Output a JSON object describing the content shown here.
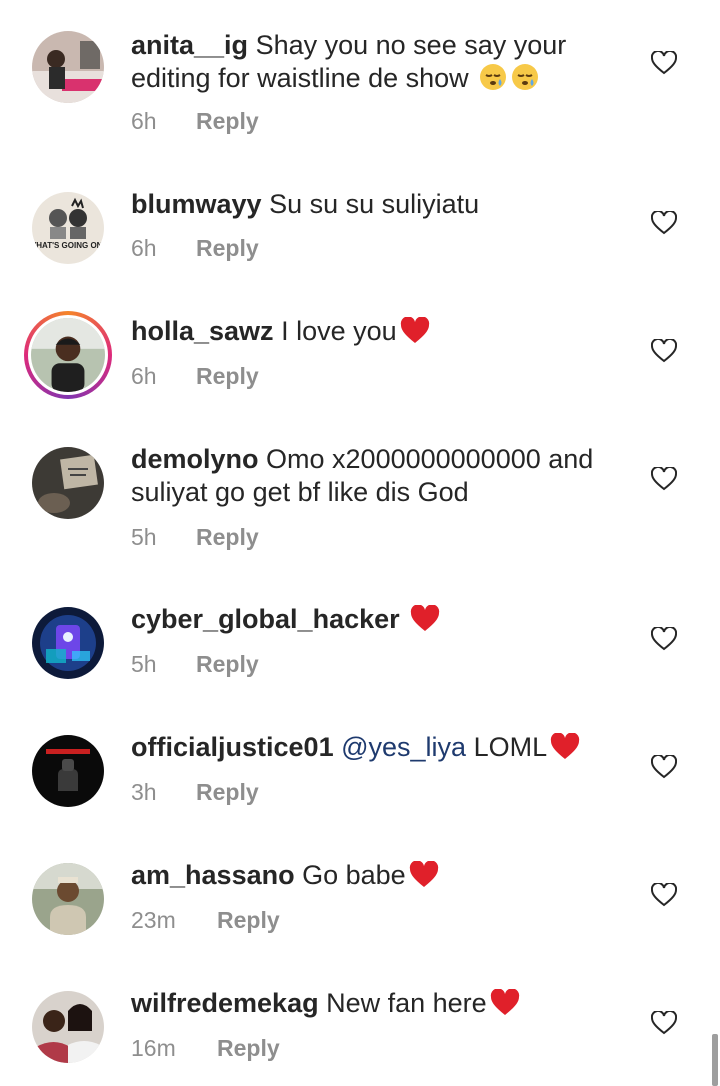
{
  "comments": [
    {
      "username": "anita__ig",
      "text": "Shay you no see say your editing for waistline de show",
      "emojis": [
        "sleepy-face",
        "sleepy-face"
      ],
      "time": "6h",
      "reply": "Reply"
    },
    {
      "username": "blumwayy",
      "text": "Su su su suliyiatu",
      "time": "6h",
      "reply": "Reply",
      "avatar_caption": "WHAT'S GOING ON?"
    },
    {
      "username": "holla_sawz",
      "text": "I love you",
      "emojis": [
        "red-heart"
      ],
      "time": "6h",
      "reply": "Reply"
    },
    {
      "username": "demolyno",
      "text": "Omo x2000000000000 and suliyat go get bf like dis God",
      "time": "5h",
      "reply": "Reply"
    },
    {
      "username": "cyber_global_hacker",
      "text": "",
      "emojis": [
        "red-heart"
      ],
      "time": "5h",
      "reply": "Reply"
    },
    {
      "username": "officialjustice01",
      "mention": "@yes_liya",
      "text": "LOML",
      "emojis": [
        "red-heart"
      ],
      "time": "3h",
      "reply": "Reply"
    },
    {
      "username": "am_hassano",
      "text": "Go babe",
      "emojis": [
        "red-heart"
      ],
      "time": "23m",
      "reply": "Reply"
    },
    {
      "username": "wilfredemekag",
      "text": "New fan here",
      "emojis": [
        "red-heart"
      ],
      "time": "16m",
      "reply": "Reply"
    }
  ],
  "colors": {
    "text": "#262626",
    "meta": "#8e8e8e",
    "mention": "#1e3a6e",
    "heart_emoji": "#e0202a"
  },
  "icons": {
    "like": "heart-outline-icon"
  }
}
